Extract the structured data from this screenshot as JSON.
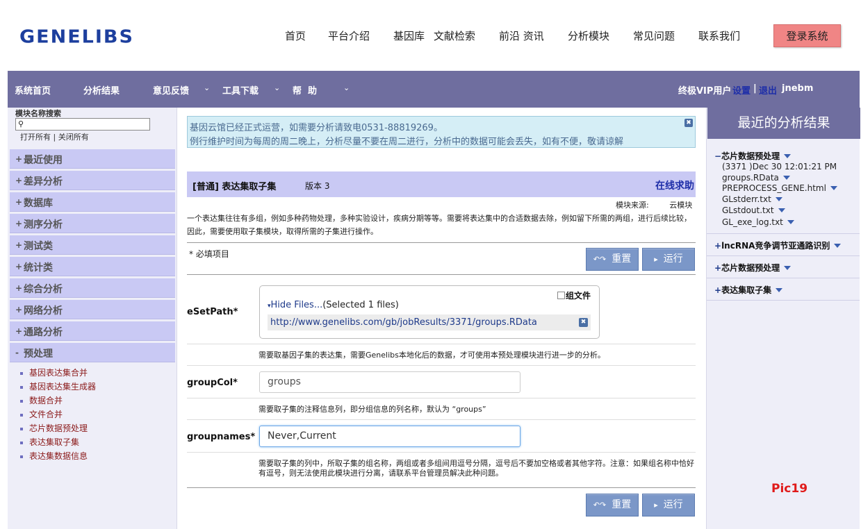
{
  "header": {
    "logo": "GENELIBS",
    "nav": [
      "首页",
      "平台介绍",
      "基因库",
      "文献检索",
      "前沿 资讯",
      "分析模块",
      "常见问题",
      "联系我们"
    ],
    "login": "登录系统"
  },
  "menubar": {
    "items": [
      "系统首页",
      "分析结果",
      "意见反馈",
      "工具下载",
      "帮  助"
    ],
    "user_level": "终极VIP用户",
    "settings": "设置",
    "sep": "|",
    "logout": "退出",
    "username": "jnebm"
  },
  "sidebar": {
    "search_title": "模块名称搜索",
    "search_value": "",
    "open_all": "打开所有",
    "divider": "|",
    "close_all": "关闭所有",
    "categories": [
      {
        "sign": "+",
        "label": "最近使用"
      },
      {
        "sign": "+",
        "label": "差异分析"
      },
      {
        "sign": "+",
        "label": "数据库"
      },
      {
        "sign": "+",
        "label": "测序分析"
      },
      {
        "sign": "+",
        "label": "测试类"
      },
      {
        "sign": "+",
        "label": "统计类"
      },
      {
        "sign": "+",
        "label": "综合分析"
      },
      {
        "sign": "+",
        "label": "网络分析"
      },
      {
        "sign": "+",
        "label": "通路分析"
      },
      {
        "sign": "-",
        "label": "预处理"
      }
    ],
    "subitems": [
      "基因表达集合并",
      "基因表达集生成器",
      "数据合并",
      "文件合并",
      "芯片数据预处理",
      "表达集取子集",
      "表达集数据信息"
    ]
  },
  "notice": {
    "line1": "基因云馆已经正式运营，如需要分析请致电0531-88819269。",
    "line2": "例行维护时间为每周的周二晚上，分析尽量不要在周二进行，分析中的数据可能会丢失，如有不便，敬请谅解"
  },
  "module": {
    "title": "[普通] 表达集取子集",
    "version": "版本 3",
    "help": "在线求助",
    "source_label": "模块来源:",
    "source_value": "云模块",
    "description": "一个表达集往往有多组，例如多种药物处理，多种实验设计，疾病分期等等。需要将表达集中的合适数据去除，例如留下所需的两组，进行后续比较，因此，需要使用取子集模块，取得所需的子集进行操作。",
    "required_note": "* 必填项目",
    "reset": "重置",
    "run": "运行"
  },
  "fields": {
    "esetpath": {
      "label": "eSetPath*",
      "group_file": "组文件",
      "hide_files": "Hide Files...",
      "selected": "(Selected 1 files)",
      "file_url": "http://www.genelibs.com/gb/jobResults/3371/groups.RData",
      "hint": "需要取基因子集的表达集，需要Genelibs本地化后的数据，才可使用本预处理模块进行进一步的分析。"
    },
    "groupcol": {
      "label": "groupCol*",
      "value": "groups",
      "hint": "需要取子集的注释信息列，即分组信息的列名称，默认为 “groups”"
    },
    "groupnames": {
      "label": "groupnames*",
      "value": "Never,Current",
      "hint": "需要取子集的列中，所取子集的组名称，两组或者多组间用逗号分隔，逗号后不要加空格或者其他字符。注意：如果组名称中恰好有逗号，则无法使用此模块进行分离，请联系平台管理员解决此种问题。"
    }
  },
  "recent": {
    "title": "最近的分析结果",
    "groups": [
      {
        "sign": "−",
        "name": "芯片数据预处理",
        "lines": [
          "(3371 )Dec 30 12:01:21 PM",
          "groups.RData",
          "PREPROCESS_GENE.html",
          "GLstderr.txt",
          "GLstdout.txt",
          "GL_exe_log.txt"
        ]
      },
      {
        "sign": "+",
        "name": "lncRNA竞争调节亚通路识别"
      },
      {
        "sign": "+",
        "name": "芯片数据预处理"
      },
      {
        "sign": "+",
        "name": "表达集取子集"
      }
    ]
  },
  "annotation": "Pic19",
  "colors": {
    "menubar": "#6f6e9f",
    "category": "#c9c9f4",
    "login": "#f08585",
    "button": "#7b97c8",
    "accent_link": "#1e2ea8",
    "annotation": "#e01a1a"
  }
}
